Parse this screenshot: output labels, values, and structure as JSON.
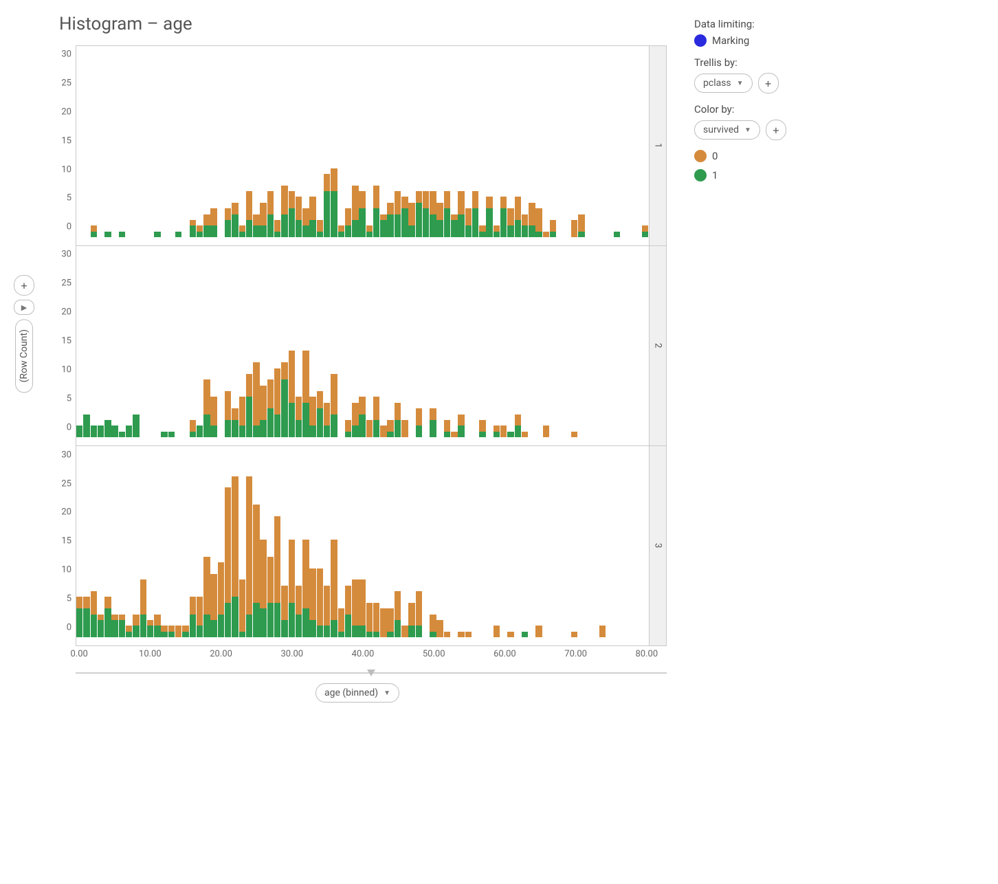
{
  "title": "Histogram – age",
  "yaxis": {
    "label": "(Row Count)",
    "plus": "+"
  },
  "xaxis": {
    "ticks": [
      "0.00",
      "10.00",
      "20.00",
      "30.00",
      "40.00",
      "50.00",
      "60.00",
      "70.00",
      "80.00"
    ],
    "button": "age (binned)"
  },
  "panel_ticks": [
    0,
    5,
    10,
    15,
    20,
    25,
    30
  ],
  "side": {
    "data_limiting_label": "Data limiting:",
    "marking_label": "Marking",
    "marking_color": "#2a2adf",
    "trellis_label": "Trellis by:",
    "trellis_value": "pclass",
    "color_label": "Color by:",
    "color_value": "survived",
    "plus": "+",
    "legend": [
      {
        "name": "0",
        "color": "#d58b3c"
      },
      {
        "name": "1",
        "color": "#2e9b4f"
      }
    ]
  },
  "chart_data": {
    "type": "bar",
    "title": "Histogram – age",
    "xlabel": "age (binned)",
    "ylabel": "(Row Count)",
    "ylim": [
      0,
      32
    ],
    "x": [
      0,
      1,
      2,
      3,
      4,
      5,
      6,
      7,
      8,
      9,
      10,
      11,
      12,
      13,
      14,
      15,
      16,
      17,
      18,
      19,
      20,
      21,
      22,
      23,
      24,
      25,
      26,
      27,
      28,
      29,
      30,
      31,
      32,
      33,
      34,
      35,
      36,
      37,
      38,
      39,
      40,
      41,
      42,
      43,
      44,
      45,
      46,
      47,
      48,
      49,
      50,
      51,
      52,
      53,
      54,
      55,
      56,
      57,
      58,
      59,
      60,
      61,
      62,
      63,
      64,
      65,
      66,
      67,
      68,
      69,
      70,
      71,
      72,
      73,
      74,
      75,
      76,
      77,
      78,
      79,
      80
    ],
    "trellis_by": "pclass",
    "trellis_levels": [
      "1",
      "2",
      "3"
    ],
    "color_by": "survived",
    "series_levels": [
      "0",
      "1"
    ],
    "panels": [
      {
        "trellis": "1",
        "series": [
          {
            "name": "1",
            "values": [
              0,
              0,
              1,
              0,
              1,
              0,
              1,
              0,
              0,
              0,
              0,
              1,
              0,
              0,
              1,
              0,
              2,
              1,
              2,
              2,
              0,
              3,
              4,
              1,
              3,
              2,
              2,
              4,
              1,
              4,
              5,
              3,
              2,
              3,
              1,
              8,
              8,
              1,
              2,
              3,
              5,
              1,
              5,
              3,
              4,
              4,
              5,
              2,
              6,
              5,
              4,
              3,
              5,
              3,
              4,
              2,
              5,
              1,
              5,
              1,
              5,
              2,
              3,
              2,
              2,
              1,
              0,
              1,
              0,
              0,
              0,
              1,
              0,
              0,
              0,
              0,
              1,
              0,
              0,
              0,
              1
            ]
          },
          {
            "name": "0",
            "values": [
              0,
              0,
              1,
              0,
              0,
              0,
              0,
              0,
              0,
              0,
              0,
              0,
              0,
              0,
              0,
              0,
              1,
              1,
              2,
              3,
              0,
              2,
              2,
              1,
              5,
              2,
              4,
              4,
              2,
              5,
              3,
              4,
              3,
              4,
              2,
              3,
              4,
              1,
              3,
              6,
              3,
              1,
              4,
              1,
              2,
              4,
              2,
              4,
              2,
              3,
              4,
              3,
              3,
              1,
              4,
              3,
              3,
              1,
              2,
              1,
              2,
              3,
              4,
              2,
              4,
              4,
              1,
              2,
              0,
              0,
              3,
              3,
              0,
              0,
              0,
              0,
              0,
              0,
              0,
              0,
              1
            ]
          }
        ]
      },
      {
        "trellis": "2",
        "series": [
          {
            "name": "1",
            "values": [
              2,
              4,
              2,
              2,
              3,
              2,
              1,
              2,
              4,
              0,
              0,
              0,
              1,
              1,
              0,
              0,
              1,
              2,
              4,
              2,
              0,
              3,
              3,
              2,
              7,
              2,
              3,
              5,
              4,
              10,
              6,
              3,
              6,
              2,
              5,
              2,
              4,
              0,
              1,
              2,
              4,
              0,
              3,
              0,
              1,
              3,
              0,
              0,
              2,
              0,
              3,
              0,
              1,
              0,
              2,
              0,
              0,
              1,
              0,
              1,
              0,
              1,
              2,
              0,
              0,
              0,
              0,
              0,
              0,
              0,
              0,
              0,
              0,
              0,
              0,
              0,
              0,
              0,
              0,
              0,
              0
            ]
          },
          {
            "name": "0",
            "values": [
              0,
              0,
              0,
              0,
              0,
              0,
              0,
              0,
              0,
              0,
              0,
              0,
              0,
              0,
              0,
              0,
              2,
              0,
              6,
              5,
              0,
              5,
              2,
              5,
              4,
              11,
              6,
              5,
              8,
              3,
              9,
              4,
              9,
              5,
              3,
              4,
              7,
              0,
              2,
              4,
              3,
              3,
              4,
              2,
              2,
              3,
              3,
              0,
              3,
              0,
              2,
              0,
              2,
              1,
              2,
              0,
              0,
              2,
              0,
              1,
              2,
              0,
              2,
              1,
              0,
              0,
              2,
              0,
              0,
              0,
              1,
              0,
              0,
              0,
              0,
              0,
              0,
              0,
              0,
              0,
              0
            ]
          }
        ]
      },
      {
        "trellis": "3",
        "series": [
          {
            "name": "1",
            "values": [
              5,
              5,
              4,
              3,
              5,
              3,
              3,
              1,
              2,
              4,
              2,
              2,
              1,
              1,
              0,
              1,
              4,
              2,
              4,
              3,
              4,
              6,
              7,
              1,
              4,
              6,
              5,
              6,
              6,
              3,
              6,
              4,
              5,
              3,
              2,
              2,
              3,
              1,
              4,
              2,
              2,
              1,
              1,
              0,
              1,
              3,
              0,
              2,
              2,
              0,
              1,
              0,
              0,
              0,
              0,
              0,
              0,
              0,
              0,
              0,
              0,
              0,
              0,
              1,
              0,
              0,
              0,
              0,
              0,
              0,
              0,
              0,
              0,
              0,
              0,
              0,
              0,
              0,
              0,
              0,
              0
            ]
          },
          {
            "name": "0",
            "values": [
              2,
              2,
              4,
              1,
              2,
              1,
              1,
              1,
              2,
              6,
              1,
              2,
              1,
              1,
              2,
              1,
              3,
              5,
              10,
              8,
              9,
              20,
              21,
              9,
              24,
              17,
              12,
              8,
              15,
              6,
              11,
              5,
              12,
              9,
              10,
              7,
              14,
              4,
              5,
              8,
              8,
              5,
              5,
              5,
              4,
              5,
              2,
              4,
              6,
              0,
              3,
              3,
              1,
              0,
              1,
              1,
              0,
              0,
              0,
              2,
              0,
              1,
              0,
              0,
              0,
              2,
              0,
              0,
              0,
              0,
              1,
              0,
              0,
              0,
              2,
              0,
              0,
              0,
              0,
              0,
              0
            ]
          }
        ]
      }
    ]
  }
}
